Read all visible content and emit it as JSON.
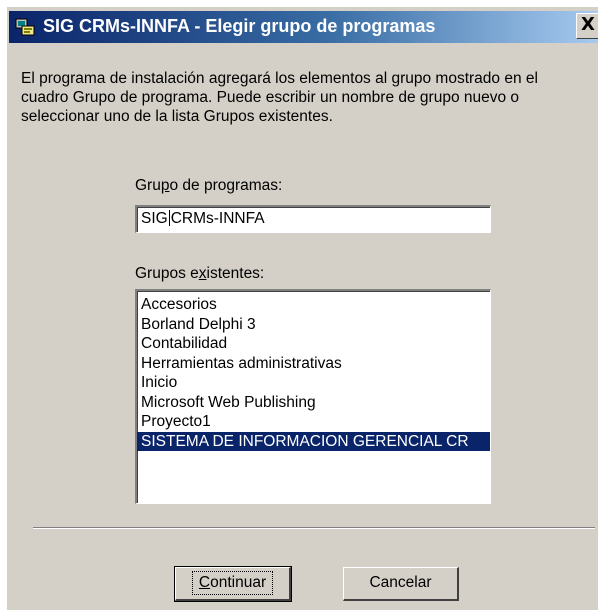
{
  "window": {
    "title": "SIG CRMs-INNFA - Elegir grupo de programas",
    "close_glyph": "X"
  },
  "instructions": "El programa de instalación agregará los elementos al grupo mostrado en el cuadro Grupo de programa. Puede escribir un nombre de grupo nuevo o seleccionar uno de la lista Grupos existentes.",
  "program_group": {
    "label_pre": "Gru",
    "label_key": "p",
    "label_post": "o de programas:",
    "value_pre": "SIG",
    "value_post": "CRMs-INNFA"
  },
  "existing_groups": {
    "label_pre": "Grupos e",
    "label_key": "x",
    "label_post": "istentes:",
    "items": [
      "Accesorios",
      "Borland Delphi 3",
      "Contabilidad",
      "Herramientas administrativas",
      "Inicio",
      "Microsoft Web Publishing",
      "Proyecto1",
      "SISTEMA DE INFORMACION GERENCIAL CR"
    ],
    "selected_index": 7
  },
  "buttons": {
    "continue_key": "C",
    "continue_rest": "ontinuar",
    "cancel": "Cancelar"
  },
  "colors": {
    "title_bar": "#0a246a",
    "selection": "#0a246a",
    "face": "#d4d0c8"
  }
}
